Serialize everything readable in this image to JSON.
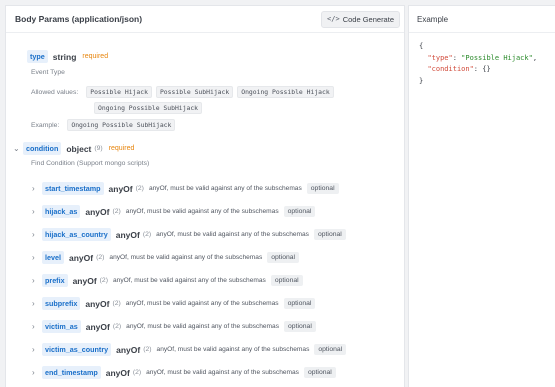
{
  "panel": {
    "title": "Body Params (application/json)",
    "code_generate_label": "Code Generate",
    "code_generate_icon": "</>"
  },
  "type_param": {
    "name": "type",
    "type": "string",
    "required": "required",
    "description": "Event Type",
    "allowed_label": "Allowed values:",
    "allowed_values": [
      "Possible Hijack",
      "Possible SubHijack",
      "Ongoing Possible Hijack",
      "Ongoing Possible SubHijack"
    ],
    "example_label": "Example:",
    "example_value": "Ongoing Possible SubHijack"
  },
  "condition_param": {
    "name": "condition",
    "type": "object",
    "count": "(9)",
    "required": "required",
    "description": "Find Condition (Support mongo scripts)"
  },
  "children": [
    {
      "name": "start_timestamp",
      "type": "anyOf",
      "count": "(2)",
      "desc": "anyOf, must be valid against any of the subschemas",
      "optional": "optional"
    },
    {
      "name": "hijack_as",
      "type": "anyOf",
      "count": "(2)",
      "desc": "anyOf, must be valid against any of the subschemas",
      "optional": "optional"
    },
    {
      "name": "hijack_as_country",
      "type": "anyOf",
      "count": "(2)",
      "desc": "anyOf, must be valid against any of the subschemas",
      "optional": "optional"
    },
    {
      "name": "level",
      "type": "anyOf",
      "count": "(2)",
      "desc": "anyOf, must be valid against any of the subschemas",
      "optional": "optional"
    },
    {
      "name": "prefix",
      "type": "anyOf",
      "count": "(2)",
      "desc": "anyOf, must be valid against any of the subschemas",
      "optional": "optional"
    },
    {
      "name": "subprefix",
      "type": "anyOf",
      "count": "(2)",
      "desc": "anyOf, must be valid against any of the subschemas",
      "optional": "optional"
    },
    {
      "name": "victim_as",
      "type": "anyOf",
      "count": "(2)",
      "desc": "anyOf, must be valid against any of the subschemas",
      "optional": "optional"
    },
    {
      "name": "victim_as_country",
      "type": "anyOf",
      "count": "(2)",
      "desc": "anyOf, must be valid against any of the subschemas",
      "optional": "optional"
    },
    {
      "name": "end_timestamp",
      "type": "anyOf",
      "count": "(2)",
      "desc": "anyOf, must be valid against any of the subschemas",
      "optional": "optional"
    }
  ],
  "example": {
    "title": "Example",
    "lines": [
      "{",
      "  \"type\": \"Possible Hijack\",",
      "  \"condition\": {}",
      "}"
    ],
    "type_key": "\"type\"",
    "type_value": "\"Possible Hijack\"",
    "condition_key": "\"condition\"",
    "condition_value": "{}"
  },
  "icons": {
    "chevron_down": "chevron-down-icon",
    "chevron_right": "chevron-right-icon",
    "code": "code-icon"
  },
  "colors": {
    "param_name": "#1a6fc9",
    "required": "#e7850d",
    "json_key": "#d14a3a",
    "json_string": "#2a8a2a"
  }
}
